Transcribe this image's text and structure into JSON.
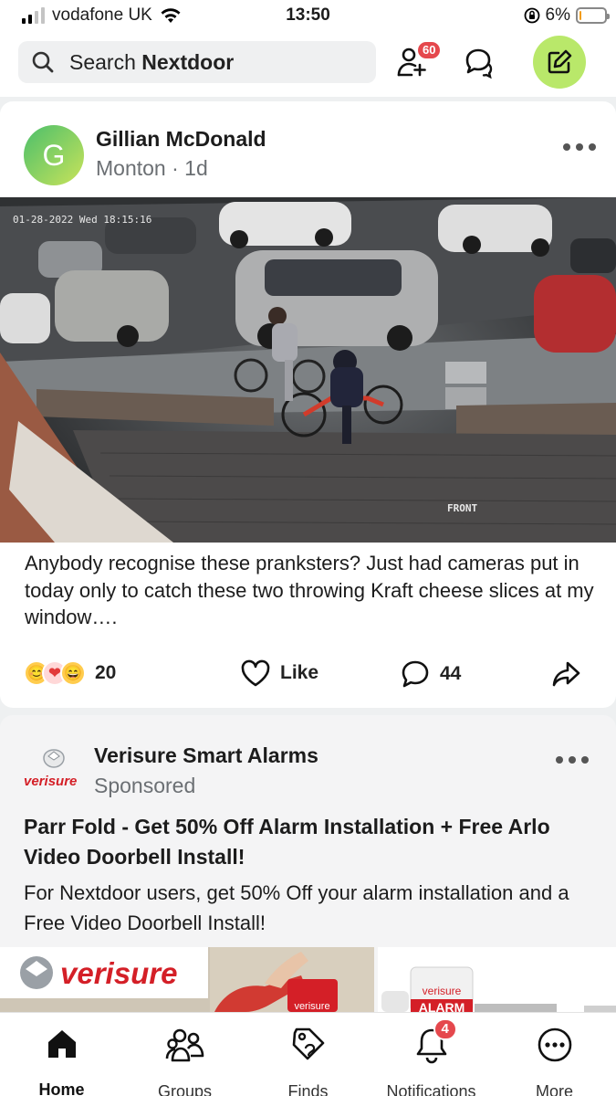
{
  "status_bar": {
    "carrier": "vodafone UK",
    "time": "13:50",
    "battery_percent_label": "6%",
    "battery_level": 0.06,
    "icons": [
      "signal-icon",
      "wifi-icon",
      "orientation-lock-icon",
      "battery-icon"
    ]
  },
  "header": {
    "search_prefix": "Search",
    "search_brand": "Nextdoor",
    "invite_badge": "60",
    "icons": [
      "search-icon",
      "add-neighbour-icon",
      "messages-icon",
      "compose-icon"
    ],
    "accent": "#b9e86a"
  },
  "post": {
    "avatar_letter": "G",
    "author": "Gillian McDonald",
    "neighbourhood": "Monton",
    "age": "1d",
    "cctv_timestamp": "01-28-2022 Wed 18:15:16",
    "cctv_label": "FRONT",
    "text": "Anybody recognise these pranksters? Just had cameras put in today only to catch these two throwing Kraft cheese slices at my window….",
    "reactions_count": "20",
    "like_label": "Like",
    "comments_count": "44",
    "reaction_emojis": [
      "😊",
      "❤",
      "😄"
    ]
  },
  "sponsored": {
    "advertiser": "Verisure Smart Alarms",
    "logo_word": "verisure",
    "label": "Sponsored",
    "title": "Parr Fold - Get 50% Off Alarm Installation + Free Arlo Video Doorbell Install!",
    "body": "For Nextdoor users, get 50% Off your alarm installation and a Free Video Doorbell Install!",
    "banner_word": "verisure",
    "sign_word": "verisure",
    "product_word": "verisure",
    "product_alarm": "ALARM",
    "brand_color": "#d41f27"
  },
  "bottom_nav": {
    "items": [
      {
        "label": "Home",
        "icon": "home-icon",
        "active": true
      },
      {
        "label": "Groups",
        "icon": "groups-icon"
      },
      {
        "label": "Finds",
        "icon": "tag-icon"
      },
      {
        "label": "Notifications",
        "icon": "bell-icon",
        "badge": "4"
      },
      {
        "label": "More",
        "icon": "more-icon"
      }
    ]
  }
}
